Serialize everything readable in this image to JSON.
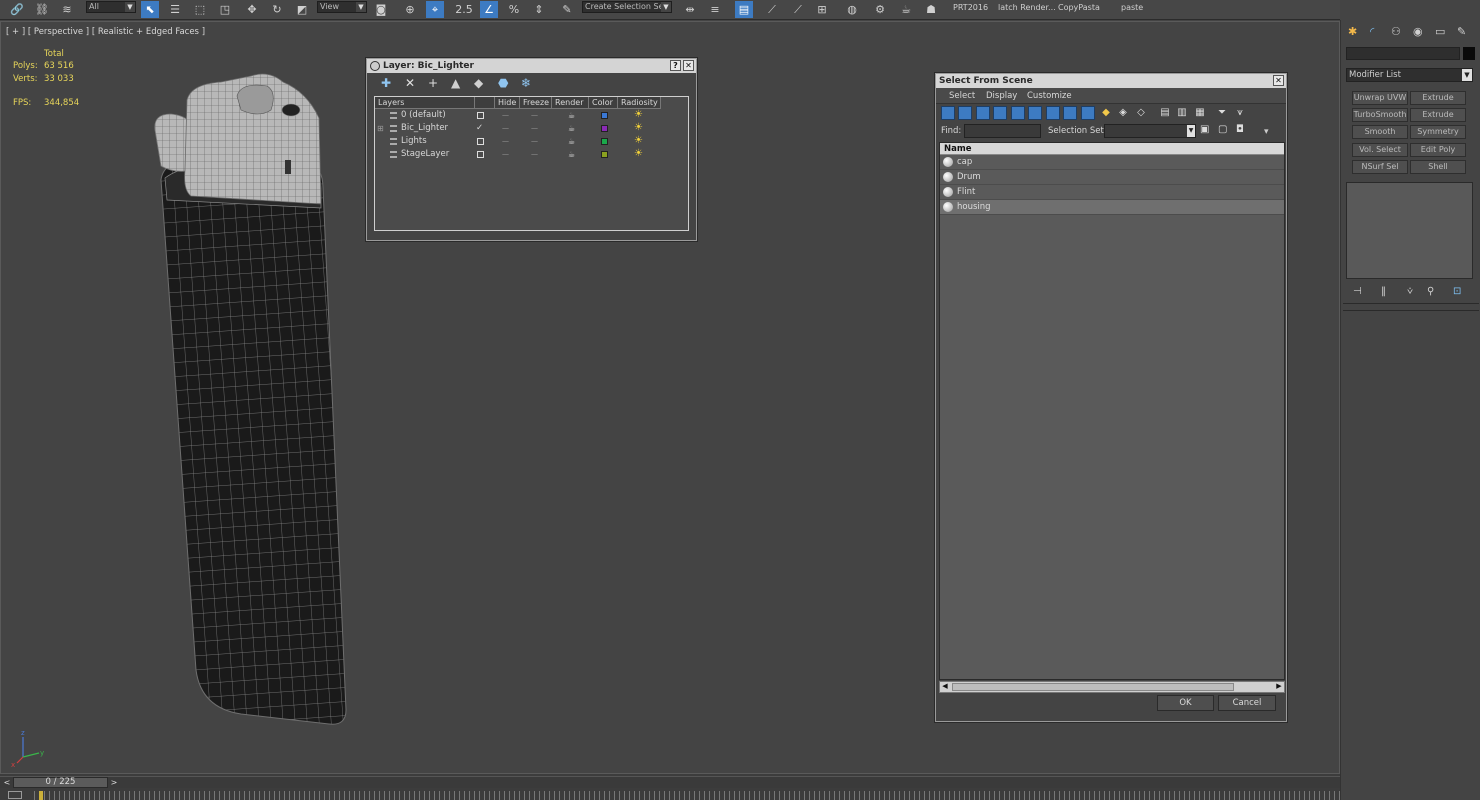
{
  "toolbar": {
    "selection_filter": "All",
    "ref_coord": "View",
    "named_sel_placeholder": "Create Selection Se",
    "custom_buttons": [
      "PRT2016",
      "latch Render...",
      "CopyPasta",
      "paste"
    ],
    "icons": {
      "link": "🔗",
      "unlink": "⛓",
      "bind": "≋",
      "select": "⬉",
      "select_name": "☰",
      "region": "⬚",
      "window": "◳",
      "move": "✥",
      "rotate": "↻",
      "scale": "◩",
      "place": "⊕",
      "pivot": "◙",
      "snap": "⌖",
      "angle_snap": "∠",
      "percent_snap": "%",
      "spinner_snap": "⇕",
      "edit_named": "✎",
      "mirror": "⇹",
      "align": "≡",
      "layer": "▤",
      "curve": "⟋",
      "schematic": "⊞",
      "material": "◍",
      "render_setup": "⚙",
      "render_frame": "▣",
      "render": "☕",
      "render_active": "☗"
    }
  },
  "viewport": {
    "label": "[ + ] [ Perspective ] [ Realistic + Edged Faces ]",
    "stats_header": "Total",
    "polys_label": "Polys:",
    "polys_value": "63 516",
    "verts_label": "Verts:",
    "verts_value": "33 033",
    "fps_label": "FPS:",
    "fps_value": "344,854",
    "axis_z": "z",
    "axis_y": "y",
    "axis_x": "x"
  },
  "layer_dialog": {
    "title": "Layer: Bic_Lighter",
    "help_btn": "?",
    "close_btn": "✕",
    "toolbar_icons": {
      "new_layer": "✚",
      "delete": "✕",
      "add": "+",
      "select": "▲",
      "highlight": "◆",
      "hide_all": "⬣",
      "freeze_all": "❄"
    },
    "columns": [
      "Layers",
      "Hide",
      "Freeze",
      "Render",
      "Color",
      "Radiosity"
    ],
    "rows": [
      {
        "name": "0 (default)",
        "color": "#3a78d4",
        "current": false
      },
      {
        "name": "Bic_Lighter",
        "color": "#8a2bb5",
        "current": true
      },
      {
        "name": "Lights",
        "color": "#1aa84a",
        "current": false
      },
      {
        "name": "StageLayer",
        "color": "#8aa020",
        "current": false
      }
    ],
    "check_mark": "✓",
    "dash": "—",
    "teapot": "☕",
    "radiosity": "☀",
    "expand": "⊞"
  },
  "scene_dialog": {
    "title": "Select From Scene",
    "close_btn": "✕",
    "menu": [
      "Select",
      "Display",
      "Customize"
    ],
    "find_label": "Find:",
    "find_value": "",
    "selection_set_label": "Selection Set:",
    "selection_set_value": "",
    "list_header": "Name",
    "items": [
      {
        "name": "cap",
        "selected": false
      },
      {
        "name": "Drum",
        "selected": false
      },
      {
        "name": "Flint",
        "selected": false
      },
      {
        "name": "housing",
        "selected": true
      }
    ],
    "ok_label": "OK",
    "cancel_label": "Cancel",
    "scroll_left": "◀",
    "scroll_right": "▶",
    "dropdown_arrow": "▼",
    "options_arrow": "▾",
    "filter_icon": "⏷",
    "filter_all_icon": "⩛",
    "list_icons": [
      "▤",
      "▥",
      "▦"
    ],
    "set_icons": [
      "▣",
      "▢",
      "◘"
    ]
  },
  "command_panel": {
    "tab_icons": [
      "✱",
      "◜",
      "⚇",
      "◉",
      "▭",
      "✎"
    ],
    "modifier_list": "Modifier List",
    "modifier_buttons": [
      [
        "Unwrap UVW",
        "Extrude"
      ],
      [
        "TurboSmooth",
        "Extrude"
      ],
      [
        "Smooth",
        "Symmetry"
      ],
      [
        "Vol. Select",
        "Edit Poly"
      ],
      [
        "NSurf Sel",
        "Shell"
      ]
    ],
    "stack_icons": [
      "⊣",
      "‖",
      "⩒",
      "⚲",
      "⊡"
    ],
    "dropdown_arrow": "▼"
  },
  "timeline": {
    "frame_label": "0 / 225",
    "prev": "<",
    "next": ">"
  }
}
